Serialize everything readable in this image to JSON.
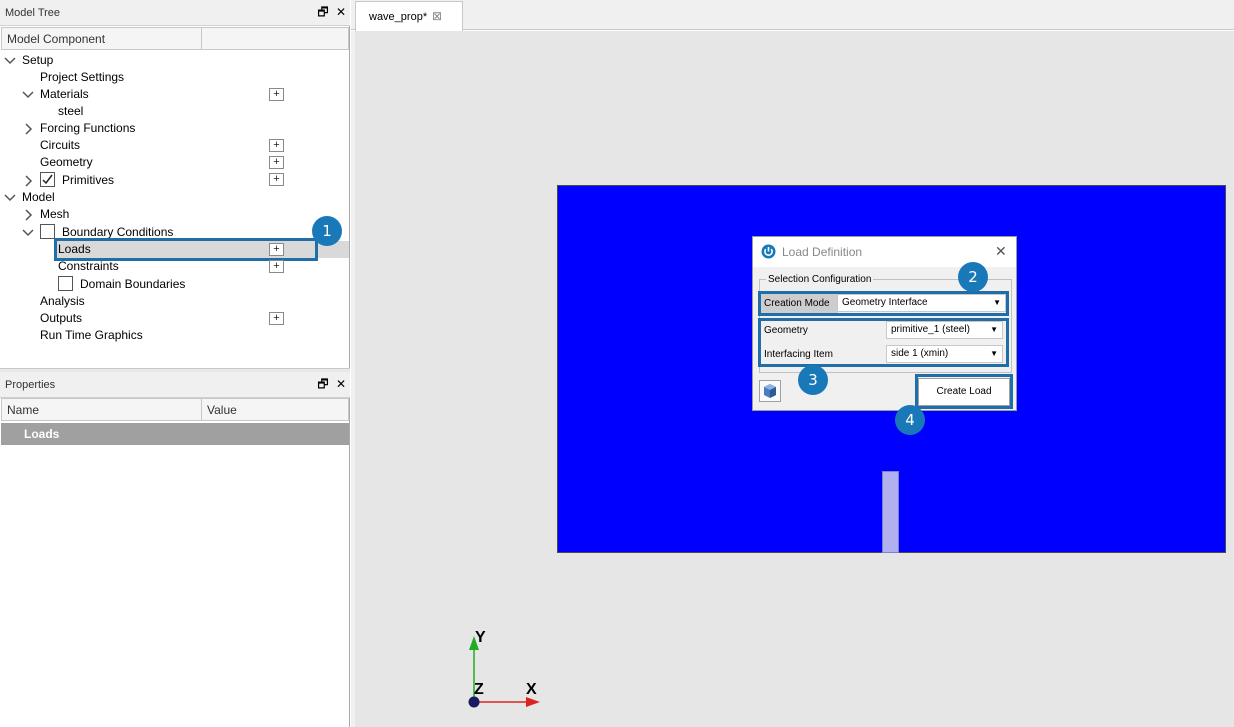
{
  "model_tree": {
    "title": "Model Tree",
    "column_component": "Model Component",
    "items": {
      "setup": "Setup",
      "project_settings": "Project Settings",
      "materials": "Materials",
      "steel": "steel",
      "forcing_functions": "Forcing Functions",
      "circuits": "Circuits",
      "geometry": "Geometry",
      "primitives": "Primitives",
      "model": "Model",
      "mesh": "Mesh",
      "boundary_conditions": "Boundary Conditions",
      "loads": "Loads",
      "constraints": "Constraints",
      "domain_boundaries": "Domain Boundaries",
      "analysis": "Analysis",
      "outputs": "Outputs",
      "run_time_graphics": "Run Time Graphics"
    },
    "plus": "+"
  },
  "properties": {
    "title": "Properties",
    "col_name": "Name",
    "col_value": "Value",
    "selected": "Loads"
  },
  "panel_controls": {
    "float": "🗗",
    "close": "✕"
  },
  "tab": {
    "label": "wave_prop*",
    "close": "⊠"
  },
  "dialog": {
    "title": "Load Definition",
    "close": "✕",
    "group": "Selection Configuration",
    "creation_mode_label": "Creation Mode",
    "creation_mode_value": "Geometry Interface",
    "geometry_label": "Geometry",
    "geometry_value": "primitive_1 (steel)",
    "interfacing_label": "Interfacing Item",
    "interfacing_value": "side 1 (xmin)",
    "create_button": "Create Load"
  },
  "callouts": [
    "1",
    "2",
    "3",
    "4"
  ],
  "axes": {
    "y": "Y",
    "z": "Z",
    "x": "X"
  },
  "colors": {
    "blue_domain": "#0000ff",
    "callout": "#1979b8",
    "axis_y": "#22aa22",
    "axis_x": "#dd2222",
    "axis_z": "#1a1a60"
  }
}
